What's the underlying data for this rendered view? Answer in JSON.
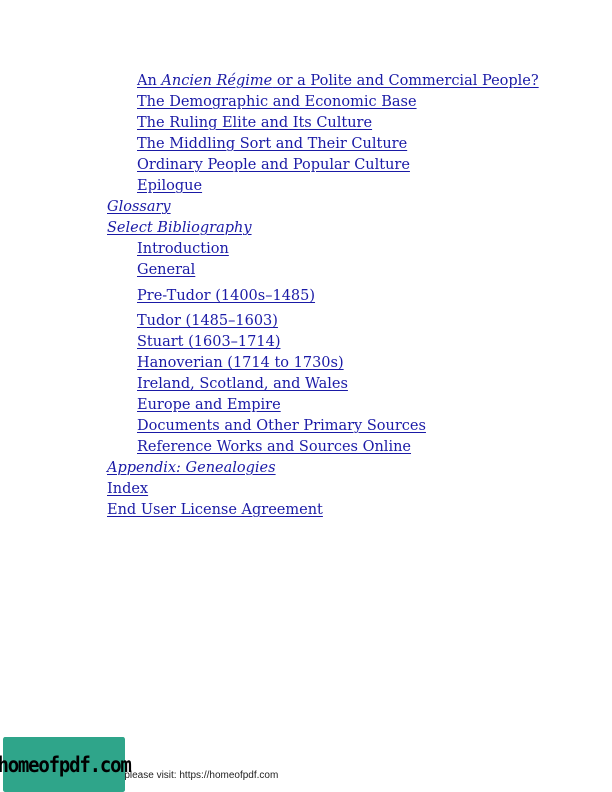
{
  "toc": {
    "items": [
      {
        "text_parts": [
          "An ",
          "Ancien Régime",
          " or a Polite and Commercial People?"
        ],
        "level": 2
      },
      {
        "text": "The Demographic and Economic Base",
        "level": 2
      },
      {
        "text": "The Ruling Elite and Its Culture",
        "level": 2
      },
      {
        "text": "The Middling Sort and Their Culture",
        "level": 2
      },
      {
        "text": "Ordinary People and Popular Culture",
        "level": 2
      },
      {
        "text": "Epilogue",
        "level": 2
      },
      {
        "text": "Glossary",
        "level": 1,
        "italic": true
      },
      {
        "text": "Select Bibliography",
        "level": 1,
        "italic": true
      },
      {
        "text": "Introduction",
        "level": 2
      },
      {
        "text": "General",
        "level": 2
      },
      {
        "text": "Pre-Tudor (1400s–1485)",
        "level": 2
      },
      {
        "text": "Tudor (1485–1603)",
        "level": 2
      },
      {
        "text": "Stuart (1603–1714)",
        "level": 2
      },
      {
        "text": "Hanoverian (1714 to 1730s)",
        "level": 2
      },
      {
        "text": "Ireland, Scotland, and Wales",
        "level": 2
      },
      {
        "text": "Europe and Empire",
        "level": 2
      },
      {
        "text": "Documents and Other Primary Sources",
        "level": 2
      },
      {
        "text": "Reference Works and Sources Online",
        "level": 2
      },
      {
        "text": "Appendix: Genealogies",
        "level": 1,
        "italic": true
      },
      {
        "text": "Index",
        "level": 1
      },
      {
        "text": "End User License Agreement",
        "level": 1
      }
    ]
  },
  "footer": {
    "text": "e please visit: https://homeofpdf.com",
    "watermark": "homeofpdf.com"
  },
  "colors": {
    "link": "#1a1aa6",
    "watermark_bg": "#2fa58a"
  }
}
